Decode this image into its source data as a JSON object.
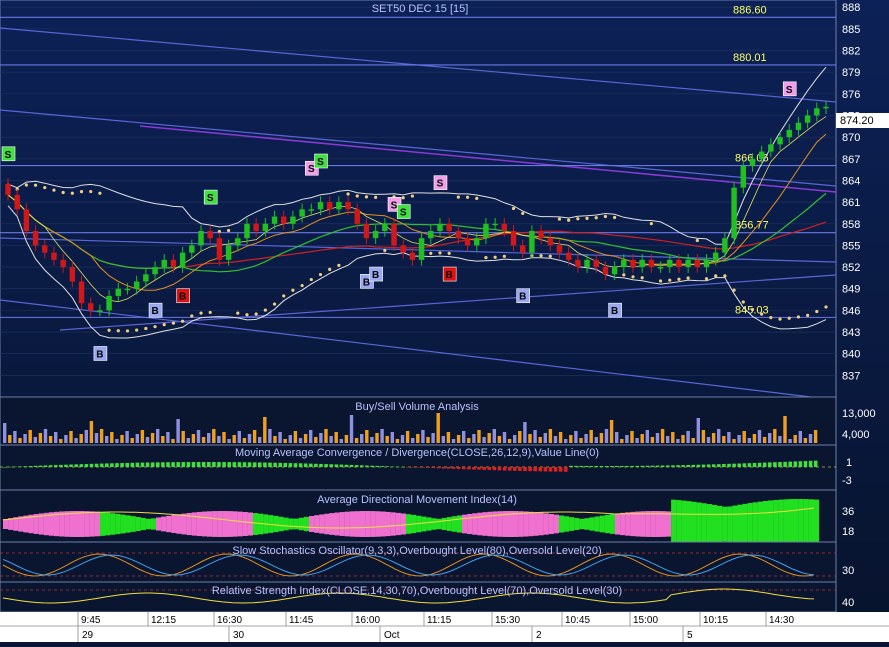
{
  "title": "SET50 DEC 15   [15]",
  "last_price": "874.20",
  "panels": {
    "volume": {
      "title": "Buy/Sell Volume Analysis",
      "ticks": [
        "13,000",
        "4,000"
      ]
    },
    "macd": {
      "title": "Moving Average Convergence / Divergence(CLOSE,26,12,9),Value Line(0)",
      "ticks": [
        "1",
        "-3"
      ]
    },
    "adx": {
      "title": "Average Directional Movement Index(14)",
      "ticks": [
        "36",
        "18"
      ]
    },
    "stoch": {
      "title": "Slow Stochastics Oscillator(9,3,3),Overbought Level(80),Oversold Level(20)",
      "ticks": [
        "30"
      ]
    },
    "rsi": {
      "title": "Relative Strength Index(CLOSE,14,30,70),Overbought Level(70),Oversold Level(30)",
      "ticks": [
        "40"
      ]
    }
  },
  "time_labels": [
    "9:45",
    "12:15",
    "16:30",
    "11:45",
    "16:00",
    "11:15",
    "15:30",
    "10:45",
    "15:00",
    "10:15",
    "14:30"
  ],
  "date_labels": [
    "29",
    "30",
    "Oct",
    "2",
    "5"
  ],
  "chart_data": {
    "type": "candlestick",
    "title": "SET50 DEC 15   [15]",
    "ylim": [
      834,
      889
    ],
    "y_ticks": [
      888,
      885,
      882,
      879,
      876,
      873,
      870,
      867,
      864,
      861,
      858,
      855,
      852,
      849,
      846,
      843,
      840,
      837
    ],
    "last_price": 874.2,
    "horizontal_levels": [
      {
        "value": 886.6,
        "label": "886.60"
      },
      {
        "value": 880.01,
        "label": "880.01"
      },
      {
        "value": 866.06,
        "label": "866.06"
      },
      {
        "value": 856.77,
        "label": "856.77"
      },
      {
        "value": 845.03,
        "label": "845.03"
      }
    ],
    "closes": [
      862,
      860,
      857,
      855,
      854,
      853,
      852,
      850,
      847,
      846,
      846,
      848,
      849,
      849,
      850,
      851,
      852,
      853,
      852,
      854,
      855,
      857,
      856,
      853,
      855,
      856,
      858,
      857,
      858,
      859,
      858,
      859,
      860,
      860,
      861,
      860,
      861,
      860,
      858,
      856,
      857,
      858,
      855,
      854,
      853,
      856,
      857,
      858,
      857,
      856,
      855,
      856,
      858,
      858,
      857,
      855,
      854,
      857,
      856,
      855,
      854,
      853,
      852,
      853,
      852,
      851,
      852,
      853,
      852,
      853,
      852,
      852,
      853,
      852,
      853,
      852,
      853,
      854,
      856,
      863,
      866,
      867,
      868,
      869,
      870,
      871,
      872,
      873,
      874,
      874.2
    ],
    "signals": [
      {
        "i": 0,
        "type": "S"
      },
      {
        "i": 10,
        "type": "B"
      },
      {
        "i": 16,
        "type": "B"
      },
      {
        "i": 19,
        "type": "B"
      },
      {
        "i": 22,
        "type": "S"
      },
      {
        "i": 33,
        "type": "S"
      },
      {
        "i": 34,
        "type": "S"
      },
      {
        "i": 39,
        "type": "B"
      },
      {
        "i": 40,
        "type": "B"
      },
      {
        "i": 42,
        "type": "S"
      },
      {
        "i": 43,
        "type": "S"
      },
      {
        "i": 47,
        "type": "S"
      },
      {
        "i": 48,
        "type": "B"
      },
      {
        "i": 56,
        "type": "B"
      },
      {
        "i": 66,
        "type": "B"
      },
      {
        "i": 85,
        "type": "S"
      }
    ]
  }
}
